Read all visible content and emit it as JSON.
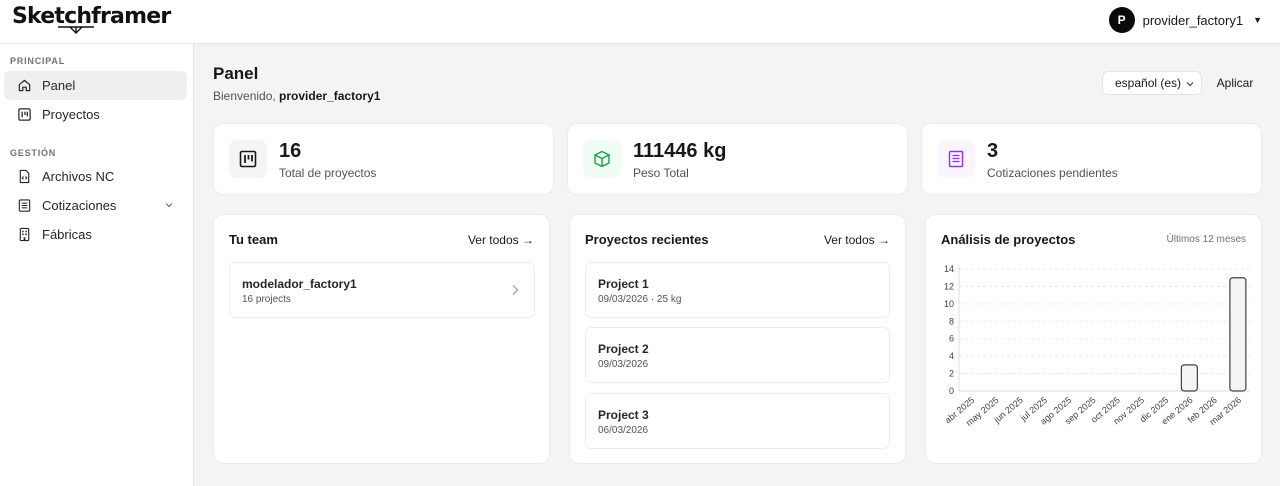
{
  "app": {
    "name": "Sketchframer"
  },
  "user": {
    "initial": "P",
    "name": "provider_factory1"
  },
  "sidebar": {
    "sections": [
      {
        "label": "PRINCIPAL"
      },
      {
        "label": "GESTIÓN"
      }
    ],
    "items": [
      {
        "label": "Panel",
        "icon": "home-icon",
        "active": true
      },
      {
        "label": "Proyectos",
        "icon": "kanban-icon"
      },
      {
        "label": "Archivos NC",
        "icon": "file-code-icon"
      },
      {
        "label": "Cotizaciones",
        "icon": "receipt-icon",
        "expandable": true
      },
      {
        "label": "Fábricas",
        "icon": "building-icon"
      }
    ]
  },
  "page": {
    "title": "Panel",
    "welcome_prefix": "Bienvenido, ",
    "welcome_user": "provider_factory1"
  },
  "language": {
    "selected": "español (es)",
    "apply_label": "Aplicar"
  },
  "stats": [
    {
      "value": "16",
      "label": "Total de proyectos",
      "icon": "kanban-icon",
      "color": "#18181b",
      "bg": "#f4f4f5"
    },
    {
      "value": "111446 kg",
      "label": "Peso Total",
      "icon": "box-icon",
      "color": "#16a34a",
      "bg": "#f0fdf4"
    },
    {
      "value": "3",
      "label": "Cotizaciones pendientes",
      "icon": "receipt-icon",
      "color": "#9333ea",
      "bg": "#faf5ff"
    }
  ],
  "team": {
    "title": "Tu team",
    "link": "Ver todos →",
    "members": [
      {
        "name": "modelador_factory1",
        "meta": "16 projects"
      }
    ]
  },
  "recent": {
    "title": "Proyectos recientes",
    "link": "Ver todos →",
    "projects": [
      {
        "name": "Project 1",
        "meta": "09/03/2026 · 25 kg"
      },
      {
        "name": "Project 2",
        "meta": "09/03/2026"
      },
      {
        "name": "Project 3",
        "meta": "06/03/2026"
      }
    ]
  },
  "analysis": {
    "title": "Análisis de proyectos",
    "period": "Últimos 12 meses"
  },
  "chart_data": {
    "type": "bar",
    "categories": [
      "abr 2025",
      "may 2025",
      "jun 2025",
      "jul 2025",
      "ago 2025",
      "sep 2025",
      "oct 2025",
      "nov 2025",
      "dic 2025",
      "ene 2026",
      "feb 2026",
      "mar 2026"
    ],
    "values": [
      0,
      0,
      0,
      0,
      0,
      0,
      0,
      0,
      0,
      3,
      0,
      13
    ],
    "yticks": [
      0,
      2,
      4,
      6,
      8,
      10,
      12,
      14
    ],
    "ylim": [
      0,
      14
    ],
    "grid": true,
    "bar_color": "#f4f4f5",
    "bar_stroke": "#3f3f46"
  }
}
